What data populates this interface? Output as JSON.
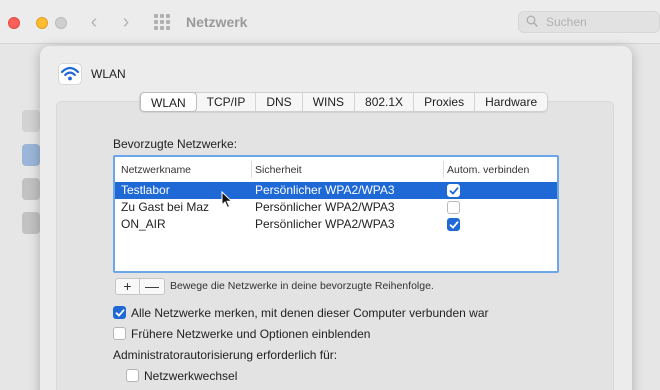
{
  "window": {
    "title": "Netzwerk",
    "search_placeholder": "Suchen"
  },
  "sheet": {
    "title": "WLAN",
    "tabs": [
      {
        "label": "WLAN",
        "active": true
      },
      {
        "label": "TCP/IP"
      },
      {
        "label": "DNS"
      },
      {
        "label": "WINS"
      },
      {
        "label": "802.1X"
      },
      {
        "label": "Proxies"
      },
      {
        "label": "Hardware"
      }
    ],
    "preferred_label": "Bevorzugte Netzwerke:",
    "table": {
      "headers": [
        "Netzwerkname",
        "Sicherheit",
        "Autom. verbinden"
      ],
      "rows": [
        {
          "name": "Testlabor",
          "security": "Persönlicher WPA2/WPA3",
          "auto_join": true,
          "selected": true
        },
        {
          "name": "Zu Gast bei Maz",
          "security": "Persönlicher WPA2/WPA3",
          "auto_join": false,
          "selected": false
        },
        {
          "name": "ON_AIR",
          "security": "Persönlicher WPA2/WPA3",
          "auto_join": true,
          "selected": false
        }
      ]
    },
    "add_label": "+",
    "remove_label": "—",
    "reorder_hint": "Bewege die Netzwerke in deine bevorzugte Reihenfolge.",
    "remember_networks": {
      "label": "Alle Netzwerke merken, mit denen dieser Computer verbunden war",
      "checked": true
    },
    "show_legacy": {
      "label": "Frühere Netzwerke und Optionen einblenden",
      "checked": false
    },
    "admin_label": "Administratorautorisierung erforderlich für:",
    "network_change": {
      "label": "Netzwerkwechsel",
      "checked": false
    }
  },
  "colors": {
    "accent": "#1f69d6",
    "focus_ring": "#6aa6e8"
  }
}
